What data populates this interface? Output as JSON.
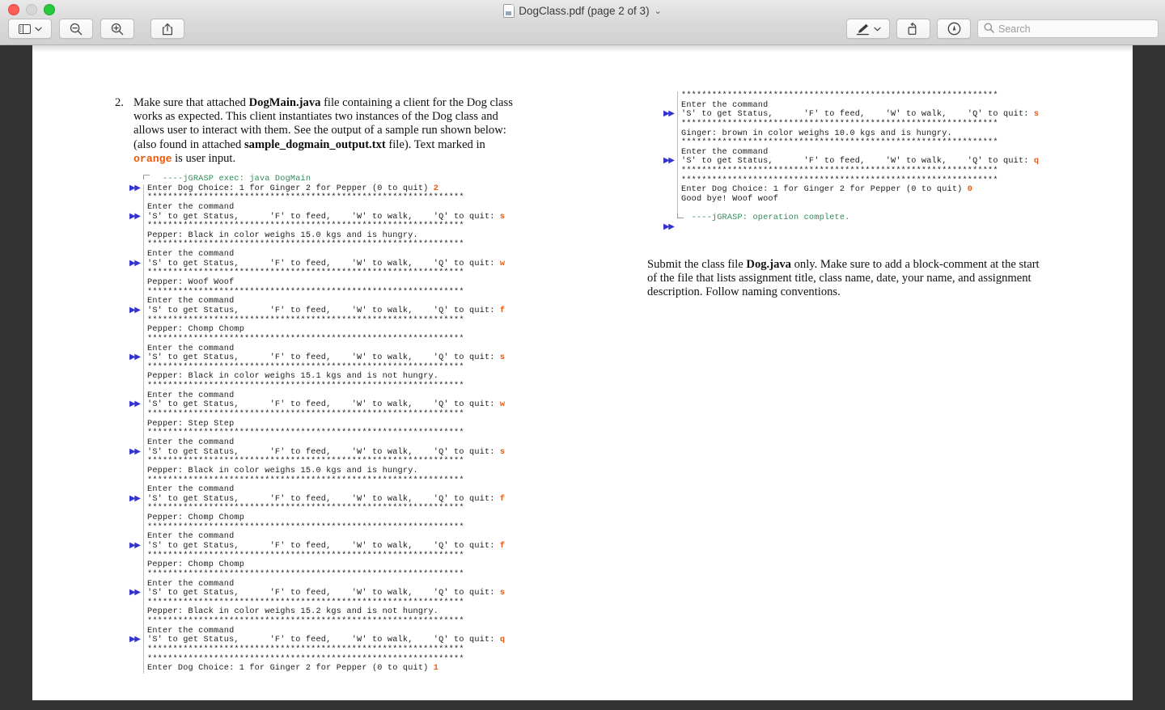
{
  "window": {
    "title": "DogClass.pdf (page 2 of 3)",
    "title_chevron": "⌄",
    "traffic_lights": [
      "close",
      "minimize",
      "maximize"
    ]
  },
  "toolbar": {
    "sidebar_button": "sidebar-view",
    "sidebar_chevron": "⌄",
    "zoom_out_button": "zoom-out",
    "zoom_in_button": "zoom-in",
    "share_button": "share",
    "markup_button": "markup",
    "markup_chevron": "⌄",
    "rotate_button": "rotate-left",
    "annotate_button": "annotate",
    "search": {
      "placeholder": "Search",
      "value": ""
    }
  },
  "document": {
    "item2": {
      "number": "2.",
      "line1_a": "Make sure that attached ",
      "line1_b": "DogMain.java",
      "line1_c": " file containing a client for the Dog class works as expected. This client instantiates two instances of the Dog class and allows user to interact with them. See the output of a sample run shown below: (also found in attached ",
      "line1_d": "sample_dogmain_output.txt",
      "line1_e": " file). Text marked in ",
      "orange_word": "orange",
      "line1_f": " is user input."
    },
    "submit_para": {
      "a": "Submit the class file ",
      "b": "Dog.java",
      "c": " only. Make sure to add a block-comment at the start of the file that lists assignment title, class name, date, your name, and assignment description. Follow naming conventions."
    }
  },
  "console_left": {
    "stars": "**************************************************************",
    "rows": [
      {
        "marker": false,
        "bracket": "top",
        "text": "   ----jGRASP exec: java DogMain",
        "style": "green"
      },
      {
        "marker": true,
        "text": "Enter Dog Choice: 1 for Ginger 2 for Pepper (0 to quit) ",
        "input": "2"
      },
      {
        "marker": false,
        "text": "STARS"
      },
      {
        "marker": false,
        "text": "Enter the command"
      },
      {
        "marker": true,
        "text": "'S' to get Status,      'F' to feed,    'W' to walk,    'Q' to quit: ",
        "input": "s"
      },
      {
        "marker": false,
        "text": "STARS"
      },
      {
        "marker": false,
        "text": "Pepper: Black in color weighs 15.0 kgs and is hungry."
      },
      {
        "marker": false,
        "text": "STARS"
      },
      {
        "marker": false,
        "text": "Enter the command"
      },
      {
        "marker": true,
        "text": "'S' to get Status,      'F' to feed,    'W' to walk,    'Q' to quit: ",
        "input": "w"
      },
      {
        "marker": false,
        "text": "STARS"
      },
      {
        "marker": false,
        "text": "Pepper: Woof Woof"
      },
      {
        "marker": false,
        "text": "STARS"
      },
      {
        "marker": false,
        "text": "Enter the command"
      },
      {
        "marker": true,
        "text": "'S' to get Status,      'F' to feed,    'W' to walk,    'Q' to quit: ",
        "input": "f"
      },
      {
        "marker": false,
        "text": "STARS"
      },
      {
        "marker": false,
        "text": "Pepper: Chomp Chomp"
      },
      {
        "marker": false,
        "text": "STARS"
      },
      {
        "marker": false,
        "text": "Enter the command"
      },
      {
        "marker": true,
        "text": "'S' to get Status,      'F' to feed,    'W' to walk,    'Q' to quit: ",
        "input": "s"
      },
      {
        "marker": false,
        "text": "STARS"
      },
      {
        "marker": false,
        "text": "Pepper: Black in color weighs 15.1 kgs and is not hungry."
      },
      {
        "marker": false,
        "text": "STARS"
      },
      {
        "marker": false,
        "text": "Enter the command"
      },
      {
        "marker": true,
        "text": "'S' to get Status,      'F' to feed,    'W' to walk,    'Q' to quit: ",
        "input": "w"
      },
      {
        "marker": false,
        "text": "STARS"
      },
      {
        "marker": false,
        "text": "Pepper: Step Step"
      },
      {
        "marker": false,
        "text": "STARS"
      },
      {
        "marker": false,
        "text": "Enter the command"
      },
      {
        "marker": true,
        "text": "'S' to get Status,      'F' to feed,    'W' to walk,    'Q' to quit: ",
        "input": "s"
      },
      {
        "marker": false,
        "text": "STARS"
      },
      {
        "marker": false,
        "text": "Pepper: Black in color weighs 15.0 kgs and is hungry."
      },
      {
        "marker": false,
        "text": "STARS"
      },
      {
        "marker": false,
        "text": "Enter the command"
      },
      {
        "marker": true,
        "text": "'S' to get Status,      'F' to feed,    'W' to walk,    'Q' to quit: ",
        "input": "f"
      },
      {
        "marker": false,
        "text": "STARS"
      },
      {
        "marker": false,
        "text": "Pepper: Chomp Chomp"
      },
      {
        "marker": false,
        "text": "STARS"
      },
      {
        "marker": false,
        "text": "Enter the command"
      },
      {
        "marker": true,
        "text": "'S' to get Status,      'F' to feed,    'W' to walk,    'Q' to quit: ",
        "input": "f"
      },
      {
        "marker": false,
        "text": "STARS"
      },
      {
        "marker": false,
        "text": "Pepper: Chomp Chomp"
      },
      {
        "marker": false,
        "text": "STARS"
      },
      {
        "marker": false,
        "text": "Enter the command"
      },
      {
        "marker": true,
        "text": "'S' to get Status,      'F' to feed,    'W' to walk,    'Q' to quit: ",
        "input": "s"
      },
      {
        "marker": false,
        "text": "STARS"
      },
      {
        "marker": false,
        "text": "Pepper: Black in color weighs 15.2 kgs and is not hungry."
      },
      {
        "marker": false,
        "text": "STARS"
      },
      {
        "marker": false,
        "text": "Enter the command"
      },
      {
        "marker": true,
        "text": "'S' to get Status,      'F' to feed,    'W' to walk,    'Q' to quit: ",
        "input": "q"
      },
      {
        "marker": false,
        "text": "STARS"
      },
      {
        "marker": false,
        "text": "STARS"
      },
      {
        "marker": false,
        "text": "Enter Dog Choice: 1 for Ginger 2 for Pepper (0 to quit) ",
        "input": "1"
      }
    ]
  },
  "console_right": {
    "rows": [
      {
        "marker": false,
        "text": "STARS"
      },
      {
        "marker": false,
        "text": "Enter the command"
      },
      {
        "marker": true,
        "text": "'S' to get Status,      'F' to feed,    'W' to walk,    'Q' to quit: ",
        "input": "s"
      },
      {
        "marker": false,
        "text": "STARS"
      },
      {
        "marker": false,
        "text": "Ginger: brown in color weighs 10.0 kgs and is hungry."
      },
      {
        "marker": false,
        "text": "STARS"
      },
      {
        "marker": false,
        "text": "Enter the command"
      },
      {
        "marker": true,
        "text": "'S' to get Status,      'F' to feed,    'W' to walk,    'Q' to quit: ",
        "input": "q"
      },
      {
        "marker": false,
        "text": "STARS"
      },
      {
        "marker": false,
        "text": "STARS"
      },
      {
        "marker": false,
        "text": "Enter Dog Choice: 1 for Ginger 2 for Pepper (0 to quit) ",
        "input": "0"
      },
      {
        "marker": false,
        "text": "Good bye! Woof woof"
      },
      {
        "marker": false,
        "text": ""
      },
      {
        "marker": false,
        "bracket": "bottom",
        "text": "  ----jGRASP: operation complete.",
        "style": "green"
      },
      {
        "marker": true,
        "text": "",
        "no_gutter": true
      }
    ]
  },
  "colors": {
    "input_orange": "#E8590C",
    "jgrasp_green": "#2E8B57",
    "marker_blue": "#3333CC",
    "page_background": "#FFFFFF",
    "viewer_background": "#333333"
  }
}
